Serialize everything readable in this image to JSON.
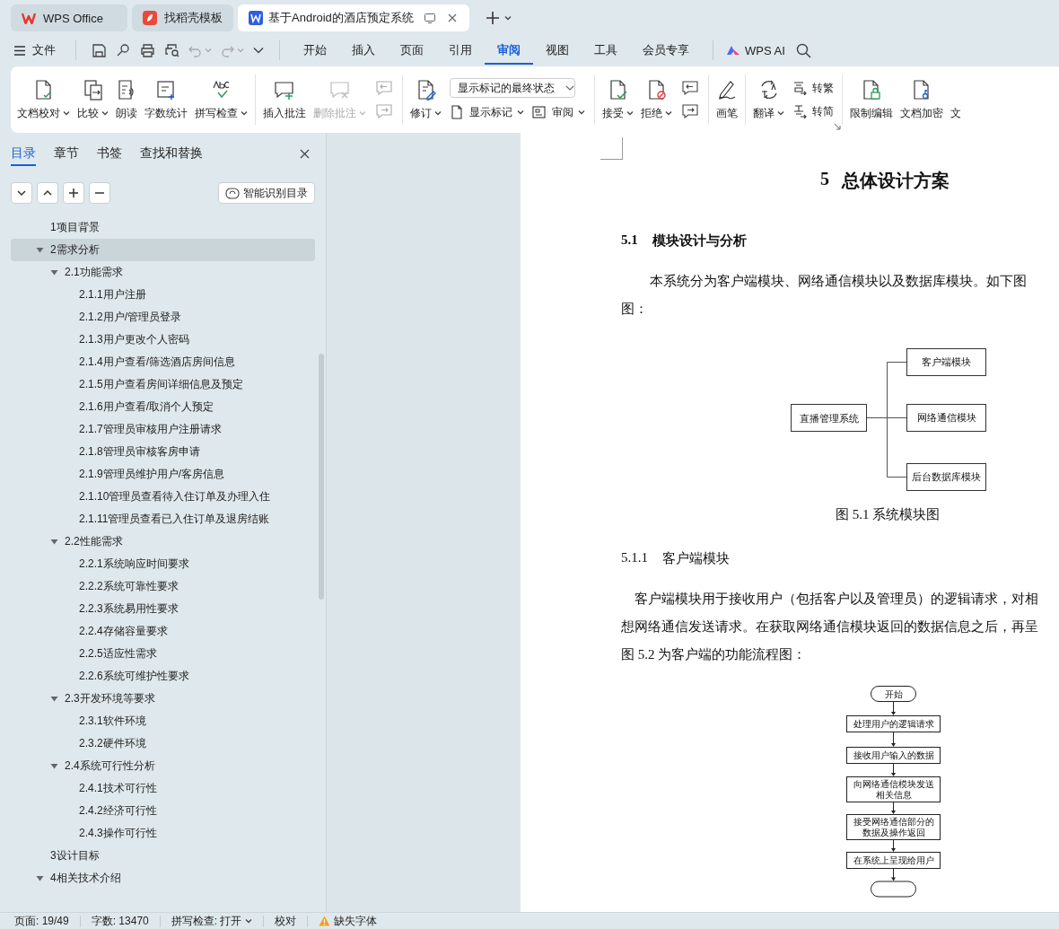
{
  "tabs": [
    {
      "kind": "home",
      "label": "WPS Office",
      "selected": false
    },
    {
      "kind": "template",
      "label": "找稻壳模板",
      "selected": false
    },
    {
      "kind": "document",
      "label": "基于Android的酒店预定系统",
      "selected": true
    }
  ],
  "menu": {
    "file": "文件",
    "tabs": [
      {
        "label": "开始",
        "selected": false
      },
      {
        "label": "插入",
        "selected": false
      },
      {
        "label": "页面",
        "selected": false
      },
      {
        "label": "引用",
        "selected": false
      },
      {
        "label": "审阅",
        "selected": true
      },
      {
        "label": "视图",
        "selected": false
      },
      {
        "label": "工具",
        "selected": false
      },
      {
        "label": "会员专享",
        "selected": false
      }
    ],
    "ai": "WPS AI"
  },
  "ribbon": [
    {
      "items": [
        {
          "kind": "large",
          "label": "文档校对",
          "dropdown": true
        },
        {
          "kind": "large",
          "label": "比较",
          "dropdown": true
        },
        {
          "kind": "large",
          "label": "朗读",
          "dropdown": false
        },
        {
          "kind": "large",
          "label": "字数统计",
          "dropdown": false
        },
        {
          "kind": "large",
          "label": "拼写检查",
          "dropdown": true
        }
      ]
    },
    {
      "items": [
        {
          "kind": "large",
          "label": "插入批注",
          "dropdown": false
        },
        {
          "kind": "large",
          "label": "删除批注",
          "dropdown": true,
          "disabled": true
        },
        {
          "kind": "stack",
          "items": [
            {
              "kind": "icon",
              "disabled": true
            },
            {
              "kind": "icon",
              "disabled": true
            }
          ]
        }
      ]
    },
    {
      "items": [
        {
          "kind": "large",
          "label": "修订",
          "dropdown": true
        },
        {
          "kind": "stack",
          "items": [
            {
              "kind": "select",
              "label": "显示标记的最终状态"
            },
            {
              "kind": "row",
              "items": [
                {
                  "kind": "compact",
                  "label": "显示标记",
                  "dropdown": true
                },
                {
                  "kind": "compact",
                  "label": "审阅",
                  "dropdown": true
                }
              ]
            }
          ]
        }
      ]
    },
    {
      "items": [
        {
          "kind": "large",
          "label": "接受",
          "dropdown": true
        },
        {
          "kind": "large",
          "label": "拒绝",
          "dropdown": true
        },
        {
          "kind": "stack",
          "items": [
            {
              "kind": "icon",
              "disabled": false
            },
            {
              "kind": "icon",
              "disabled": false
            }
          ]
        }
      ]
    },
    {
      "items": [
        {
          "kind": "large",
          "label": "画笔",
          "dropdown": false
        }
      ]
    },
    {
      "launcher": true,
      "items": [
        {
          "kind": "large",
          "label": "翻译",
          "dropdown": true
        },
        {
          "kind": "stack",
          "items": [
            {
              "kind": "compact",
              "label": "转繁",
              "dropdown": false
            },
            {
              "kind": "compact",
              "label": "转简",
              "dropdown": false
            }
          ]
        }
      ]
    },
    {
      "items": [
        {
          "kind": "large",
          "label": "限制编辑",
          "dropdown": false
        },
        {
          "kind": "large",
          "label": "文档加密",
          "dropdown": false
        },
        {
          "kind": "large",
          "label": "文",
          "dropdown": false
        }
      ]
    }
  ],
  "panel": {
    "tabs": [
      {
        "label": "目录",
        "selected": true
      },
      {
        "label": "章节",
        "selected": false
      },
      {
        "label": "书签",
        "selected": false
      },
      {
        "label": "查找和替换",
        "selected": false
      }
    ],
    "smart_button": "智能识别目录",
    "toc": [
      {
        "label": "1项目背景",
        "selected": false
      },
      {
        "label": "2需求分析",
        "selected": true,
        "expanded": true,
        "children": [
          {
            "label": "2.1功能需求",
            "selected": false,
            "expanded": true,
            "children": [
              {
                "label": "2.1.1用户注册",
                "selected": false
              },
              {
                "label": "2.1.2用户/管理员登录",
                "selected": false
              },
              {
                "label": "2.1.3用户更改个人密码",
                "selected": false
              },
              {
                "label": "2.1.4用户查看/筛选酒店房间信息",
                "selected": false
              },
              {
                "label": "2.1.5用户查看房间详细信息及预定",
                "selected": false
              },
              {
                "label": "2.1.6用户查看/取消个人预定",
                "selected": false
              },
              {
                "label": "2.1.7管理员审核用户注册请求",
                "selected": false
              },
              {
                "label": "2.1.8管理员审核客房申请",
                "selected": false
              },
              {
                "label": "2.1.9管理员维护用户/客房信息",
                "selected": false
              },
              {
                "label": "2.1.10管理员查看待入住订单及办理入住",
                "selected": false
              },
              {
                "label": "2.1.11管理员查看已入住订单及退房结账",
                "selected": false
              }
            ]
          },
          {
            "label": "2.2性能需求",
            "selected": false,
            "expanded": true,
            "children": [
              {
                "label": "2.2.1系统响应时间要求",
                "selected": false
              },
              {
                "label": "2.2.2系统可靠性要求",
                "selected": false
              },
              {
                "label": "2.2.3系统易用性要求",
                "selected": false
              },
              {
                "label": "2.2.4存储容量要求",
                "selected": false
              },
              {
                "label": "2.2.5适应性需求",
                "selected": false
              },
              {
                "label": "2.2.6系统可维护性要求",
                "selected": false
              }
            ]
          },
          {
            "label": "2.3开发环境等要求",
            "selected": false,
            "expanded": true,
            "children": [
              {
                "label": "2.3.1软件环境",
                "selected": false
              },
              {
                "label": "2.3.2硬件环境",
                "selected": false
              }
            ]
          },
          {
            "label": "2.4系统可行性分析",
            "selected": false,
            "expanded": true,
            "children": [
              {
                "label": "2.4.1技术可行性",
                "selected": false
              },
              {
                "label": "2.4.2经济可行性",
                "selected": false
              },
              {
                "label": "2.4.3操作可行性",
                "selected": false
              }
            ]
          }
        ]
      },
      {
        "label": "3设计目标",
        "selected": false
      },
      {
        "label": "4相关技术介绍",
        "selected": false,
        "expanded": true
      }
    ]
  },
  "document": {
    "title": {
      "number": "5",
      "text": "总体设计方案"
    },
    "section": {
      "number": "5.1",
      "text": "模块设计与分析"
    },
    "paragraph_1": [
      "本系统分为客户端模块、网络通信模块以及数据库模块。如下图",
      "图："
    ],
    "figure_1": {
      "root": "直播管理系统",
      "modules": [
        "客户端模块",
        "网络通信模块",
        "后台数据库模块"
      ],
      "caption": "图 5.1  系统模块图"
    },
    "subsection": {
      "number": "5.1.1",
      "text": "客户端模块"
    },
    "paragraph_2": [
      "客户端模块用于接收用户（包括客户以及管理员）的逻辑请求，对相",
      "想网络通信发送请求。在获取网络通信模块返回的数据信息之后，再呈",
      "图 5.2 为客户端的功能流程图："
    ],
    "flowchart": {
      "start": "开始",
      "steps": [
        [
          "处理用户的逻辑请求"
        ],
        [
          "接收用户输入的数据"
        ],
        [
          "向网络通信模块发送",
          "相关信息"
        ],
        [
          "接受网络通信部分的",
          "数据及操作返回"
        ],
        [
          "在系统上呈现给用户"
        ]
      ]
    }
  },
  "status_bar": {
    "page": "页面: 19/49",
    "words": "字数: 13470",
    "spell": "拼写检查: 打开",
    "proof": "校对",
    "fonts": "缺失字体"
  }
}
